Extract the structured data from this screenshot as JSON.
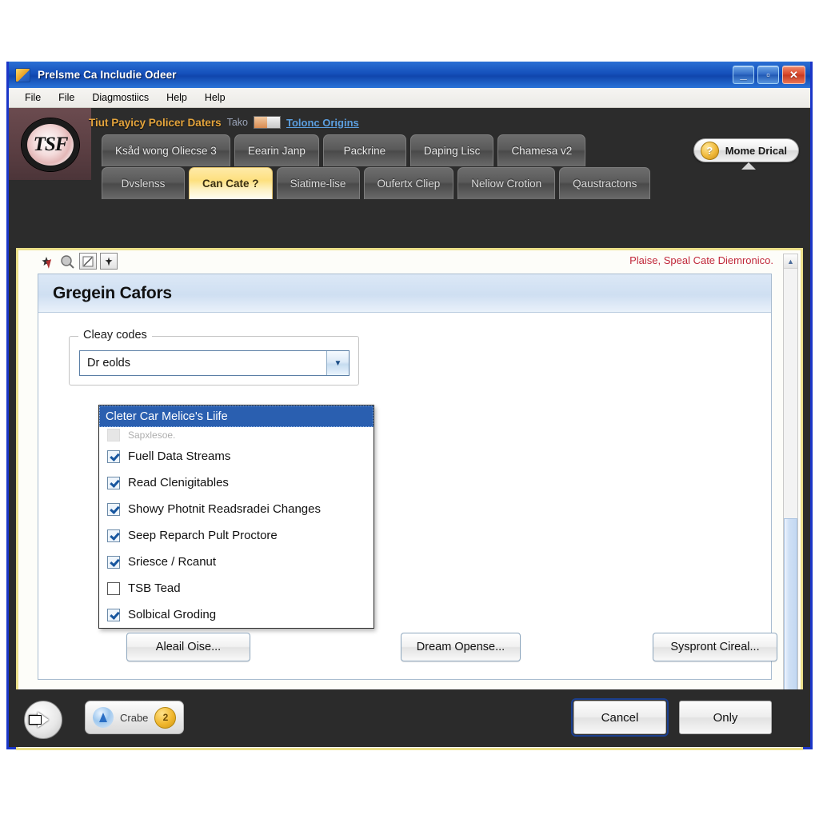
{
  "window": {
    "title": "Prelsme Ca Includie Odeer",
    "icon": "app-icon",
    "controls": {
      "minimize": "_",
      "maximize": "▫",
      "close": "✕"
    }
  },
  "menubar": {
    "items": [
      "File",
      "File",
      "Diagmostiics",
      "Help",
      "Help"
    ]
  },
  "header": {
    "logo_text": "TSF",
    "banner_bold": "Tiut Payicy Policer Daters",
    "banner_dim": "Tako",
    "banner_link": "Tolonc Origins",
    "help_button": {
      "label": "Mome Drical",
      "icon": "question-mark-icon"
    }
  },
  "tabs": {
    "row1": [
      {
        "label": "Ksåd wong Oliecse 3",
        "active": false
      },
      {
        "label": "Eearin Janp",
        "active": false
      },
      {
        "label": "Packrine",
        "active": false
      },
      {
        "label": "Daping Lisc",
        "active": false
      },
      {
        "label": "Chamesa v2",
        "active": false
      }
    ],
    "row2": [
      {
        "label": "Dvslenss",
        "active": false
      },
      {
        "label": "Can Cate ?",
        "active": true
      },
      {
        "label": "Siatime-lise",
        "active": false
      },
      {
        "label": "Oufertх Cliep",
        "active": false
      },
      {
        "label": "Neliow Crotion",
        "active": false
      },
      {
        "label": "Qaustractons",
        "active": false
      }
    ]
  },
  "toolbar": {
    "buttons": [
      {
        "name": "pin-icon",
        "glyph": "✦"
      },
      {
        "name": "magnifier-icon",
        "glyph": "○"
      },
      {
        "name": "edit-square-icon",
        "glyph": "◻"
      },
      {
        "name": "add-icon",
        "glyph": "✚"
      }
    ]
  },
  "notice": {
    "text": "Plaise, Speal Cate Diemronico."
  },
  "page": {
    "title": "Gregein Cafors",
    "groupbox": {
      "legend": "Cleay codes",
      "combo": {
        "value": "Dr eolds",
        "placeholder": "Dr eolds",
        "arrow": "chevron-down-icon"
      }
    },
    "dropdown": {
      "selected": "Cleter Car Melice's Liife",
      "items": [
        {
          "label": "Sapxlesoe.",
          "checked": false,
          "state": "gray",
          "faded": true
        },
        {
          "label": "Fuell Data Streams",
          "checked": true,
          "state": "checked"
        },
        {
          "label": "Read Clenigitables",
          "checked": true,
          "state": "checked"
        },
        {
          "label": "Showy Photnit Readsradei Changes",
          "checked": true,
          "state": "checked"
        },
        {
          "label": "Seep Reparch Pult Proctore",
          "checked": true,
          "state": "checked"
        },
        {
          "label": "Sriesce / Rcanut",
          "checked": true,
          "state": "checked"
        },
        {
          "label": "TSB Tead",
          "checked": false,
          "state": "empty"
        },
        {
          "label": "Solbical Groding",
          "checked": true,
          "state": "checked"
        }
      ]
    },
    "buttons": [
      {
        "label": "Aleail Oise..."
      },
      {
        "label": "Dream Opense..."
      },
      {
        "label": "Syspront Cireal..."
      }
    ],
    "scrollbar": {
      "up": "▲",
      "down": "▼"
    }
  },
  "bottombar": {
    "back_button": "back-arrow-icon",
    "status_pill": {
      "label": "Crabe",
      "badge": "2",
      "icon": "connection-icon"
    },
    "cancel_label": "Cancel",
    "confirm_label": "Only"
  },
  "colors": {
    "titlebar": "#1550bb",
    "accent_tab": "#fde07f",
    "selection": "#2a5fb0",
    "warning": "#c0283a",
    "frame": "#ece08a"
  }
}
